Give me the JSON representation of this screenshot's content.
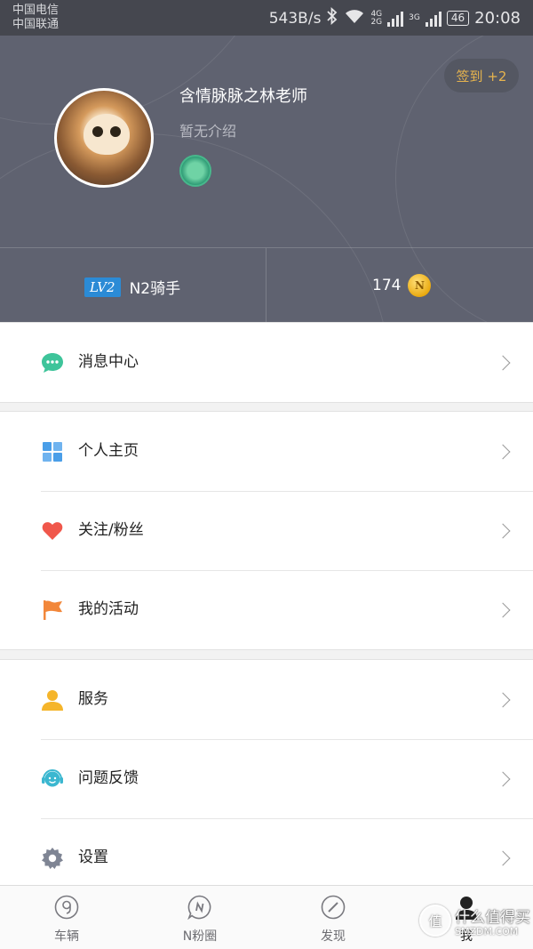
{
  "status_bar": {
    "carrier_1": "中国电信",
    "carrier_2": "中国联通",
    "net_speed": "543B/s",
    "sig1_tag_top": "4G",
    "sig1_tag_bottom": "2G",
    "sig2_tag": "3G",
    "battery": "46",
    "time": "20:08"
  },
  "profile": {
    "username": "含情脉脉之林老师",
    "intro": "暂无介绍",
    "checkin_label": "签到 +2",
    "level_tag": "LV2",
    "level_name": "N2骑手",
    "coin_count": "174",
    "coin_symbol": "N"
  },
  "menu": {
    "message_center": "消息中心",
    "homepage": "个人主页",
    "follow_fans": "关注/粉丝",
    "my_activities": "我的活动",
    "services": "服务",
    "feedback": "问题反馈",
    "settings": "设置"
  },
  "tabbar": {
    "vehicle": "车辆",
    "n_circle": "N粉圈",
    "discover": "发现",
    "me": "我",
    "active": "me"
  },
  "watermark": {
    "logo_char": "值",
    "text_cn": "什么值得买",
    "text_en": "SMZDM.COM"
  },
  "colors": {
    "header_bg": "#5f6270",
    "accent_gold": "#e7b44e",
    "level_blue": "#2b8bd6",
    "message_green": "#3ec49a",
    "heart_red": "#f0574b",
    "flag_orange": "#f2873a",
    "service_yellow": "#f5b52a",
    "feedback_teal": "#3bb7d0",
    "settings_gray": "#7f8594"
  }
}
